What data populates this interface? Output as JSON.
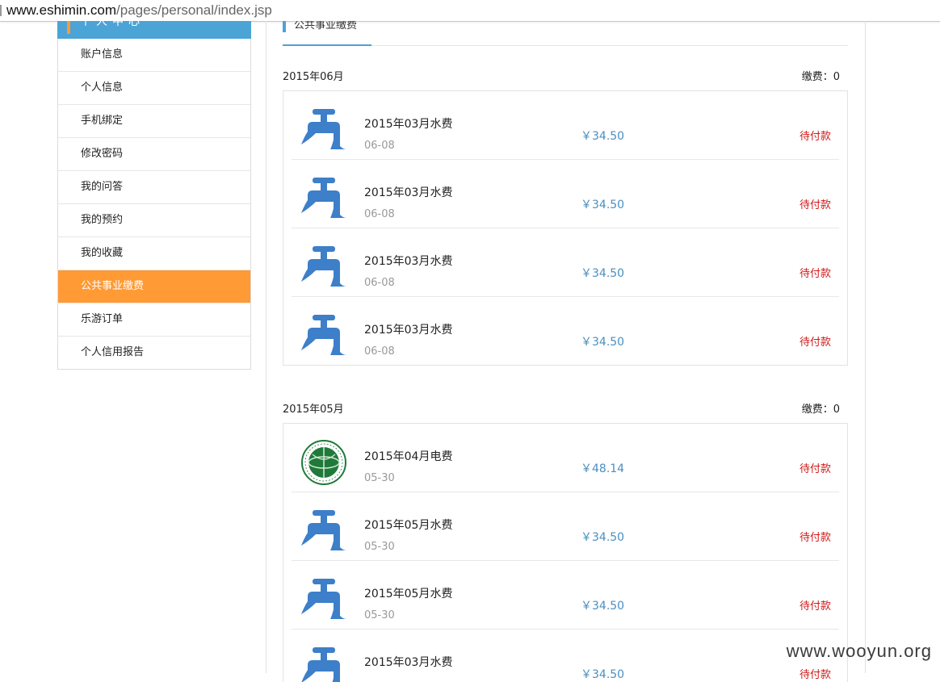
{
  "browser": {
    "url_host": "www.eshimin.com",
    "url_path": "/pages/personal/index.jsp"
  },
  "sidebar": {
    "header": "个人中心",
    "items": [
      {
        "label": "账户信息"
      },
      {
        "label": "个人信息"
      },
      {
        "label": "手机绑定"
      },
      {
        "label": "修改密码"
      },
      {
        "label": "我的问答"
      },
      {
        "label": "我的预约"
      },
      {
        "label": "我的收藏"
      },
      {
        "label": "公共事业缴费",
        "active": true
      },
      {
        "label": "乐游订单"
      },
      {
        "label": "个人信用报告"
      }
    ]
  },
  "main": {
    "tab": "公共事业缴费",
    "months": [
      {
        "label": "2015年06月",
        "pay": "缴费：0",
        "bills": [
          {
            "title": "2015年03月水费",
            "date": "06-08",
            "amount": "￥34.50",
            "status": "待付款",
            "icon": "water-tap-icon"
          },
          {
            "title": "2015年03月水费",
            "date": "06-08",
            "amount": "￥34.50",
            "status": "待付款",
            "icon": "water-tap-icon"
          },
          {
            "title": "2015年03月水费",
            "date": "06-08",
            "amount": "￥34.50",
            "status": "待付款",
            "icon": "water-tap-icon"
          },
          {
            "title": "2015年03月水费",
            "date": "06-08",
            "amount": "￥34.50",
            "status": "待付款",
            "icon": "water-tap-icon"
          }
        ]
      },
      {
        "label": "2015年05月",
        "pay": "缴费：0",
        "bills": [
          {
            "title": "2015年04月电费",
            "date": "05-30",
            "amount": "￥48.14",
            "status": "待付款",
            "icon": "state-grid-logo-icon"
          },
          {
            "title": "2015年05月水费",
            "date": "05-30",
            "amount": "￥34.50",
            "status": "待付款",
            "icon": "water-tap-icon"
          },
          {
            "title": "2015年05月水费",
            "date": "05-30",
            "amount": "￥34.50",
            "status": "待付款",
            "icon": "water-tap-icon"
          },
          {
            "title": "2015年03月水费",
            "date": "",
            "amount": "￥34.50",
            "status": "待付款",
            "icon": "water-tap-icon"
          }
        ]
      }
    ]
  },
  "watermark": "www.wooyun.org",
  "colors": {
    "accent_blue": "#4ba3d6",
    "active_orange": "#ff9a35",
    "amount_blue": "#4a8fc0",
    "status_red": "#d01818",
    "icon_blue": "#3d7fc9",
    "grid_green": "#1f7a3a"
  }
}
